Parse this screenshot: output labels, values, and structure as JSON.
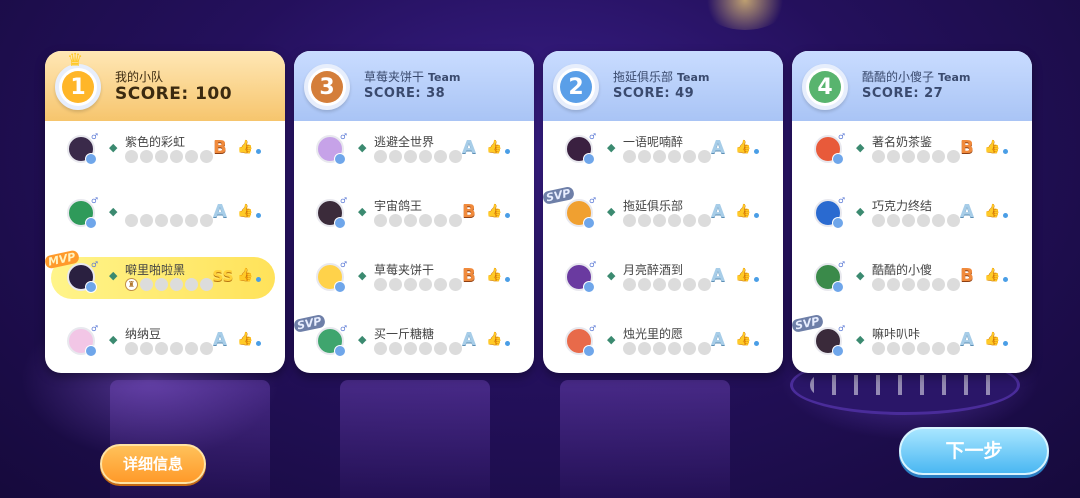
{
  "colors": {
    "rank_1": "#ffb628",
    "rank_2": "#5a9fe8",
    "rank_3": "#d47e3a",
    "rank_4": "#58b46e"
  },
  "teams": [
    {
      "rank": "1",
      "name": "我的小队",
      "suffix": "",
      "score_label": "SCORE: 100",
      "is_mine": true,
      "players": [
        {
          "name": "紫色的彩虹",
          "grade": "B",
          "tag": "",
          "avatar_color": "#3a2a4a"
        },
        {
          "name": "",
          "grade": "A",
          "tag": "",
          "avatar_color": "#2f9a5a"
        },
        {
          "name": "噼里啪啦黑",
          "grade": "SS",
          "tag": "MVP",
          "avatar_color": "#2a2040",
          "highlight": true
        },
        {
          "name": "纳纳豆",
          "grade": "A",
          "tag": "",
          "avatar_color": "#f2c6e6"
        }
      ]
    },
    {
      "rank": "3",
      "name": "草莓夹饼干",
      "suffix": "Team",
      "score_label": "SCORE: 38",
      "is_mine": false,
      "players": [
        {
          "name": "逃避全世界",
          "grade": "A",
          "tag": "",
          "avatar_color": "#c6a2e8"
        },
        {
          "name": "宇宙鸽王",
          "grade": "B",
          "tag": "",
          "avatar_color": "#3b2b3a"
        },
        {
          "name": "草莓夹饼干",
          "grade": "B",
          "tag": "",
          "avatar_color": "#ffd24a"
        },
        {
          "name": "买一斤糖糖",
          "grade": "A",
          "tag": "SVP",
          "avatar_color": "#3fa56e"
        }
      ]
    },
    {
      "rank": "2",
      "name": "拖延俱乐部",
      "suffix": "Team",
      "score_label": "SCORE: 49",
      "is_mine": false,
      "players": [
        {
          "name": "一语呢喃醉",
          "grade": "A",
          "tag": "",
          "avatar_color": "#3a2040"
        },
        {
          "name": "拖延俱乐部",
          "grade": "A",
          "tag": "SVP",
          "avatar_color": "#f0a030"
        },
        {
          "name": "月亮醉酒到",
          "grade": "A",
          "tag": "",
          "avatar_color": "#6a3aa0"
        },
        {
          "name": "烛光里的愿",
          "grade": "A",
          "tag": "",
          "avatar_color": "#e86a4a"
        }
      ]
    },
    {
      "rank": "4",
      "name": "酷酷的小傻子",
      "suffix": "Team",
      "score_label": "SCORE: 27",
      "is_mine": false,
      "players": [
        {
          "name": "著名奶茶鉴",
          "grade": "B",
          "tag": "",
          "avatar_color": "#e85a3a"
        },
        {
          "name": "巧克力终结",
          "grade": "A",
          "tag": "",
          "avatar_color": "#2a6ad0"
        },
        {
          "name": "酷酷的小傻",
          "grade": "B",
          "tag": "",
          "avatar_color": "#3a8a4a"
        },
        {
          "name": "嘛咔叭咔",
          "grade": "A",
          "tag": "SVP",
          "avatar_color": "#3a2a3a"
        }
      ]
    }
  ],
  "buttons": {
    "details": "详细信息",
    "next": "下一步"
  }
}
